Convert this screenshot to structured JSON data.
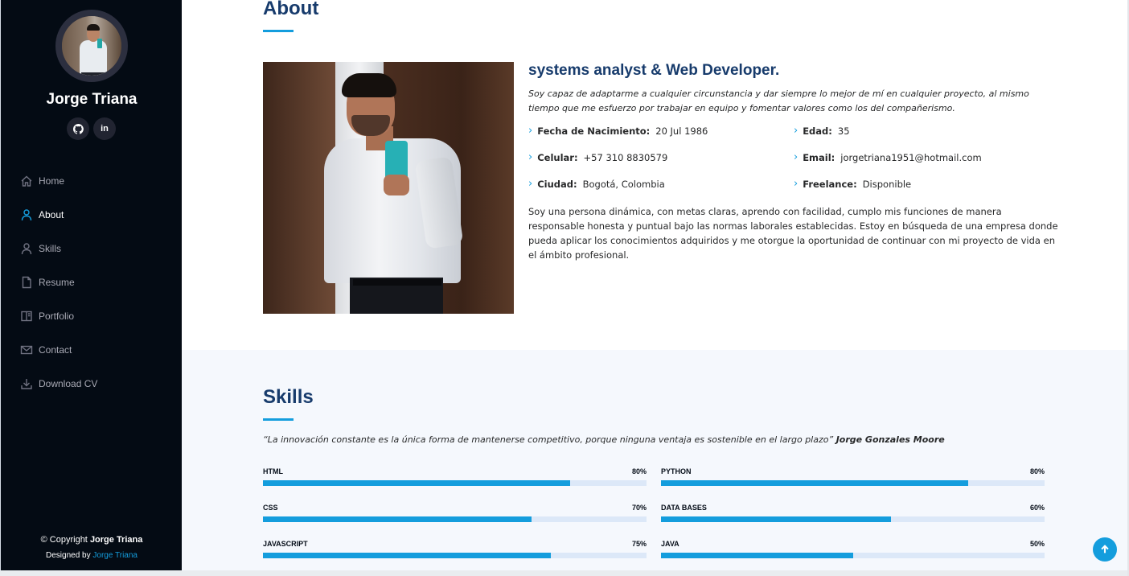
{
  "sidebar": {
    "name": "Jorge Triana",
    "social": [
      {
        "icon": "github-icon",
        "glyph": "●"
      },
      {
        "icon": "linkedin-icon",
        "glyph": "in"
      }
    ],
    "nav": [
      {
        "label": "Home",
        "icon": "home-icon"
      },
      {
        "label": "About",
        "icon": "person-icon",
        "active": true
      },
      {
        "label": "Skills",
        "icon": "person-icon"
      },
      {
        "label": "Resume",
        "icon": "file-icon"
      },
      {
        "label": "Portfolio",
        "icon": "book-icon"
      },
      {
        "label": "Contact",
        "icon": "envelope-icon"
      },
      {
        "label": "Download CV",
        "icon": "download-icon"
      }
    ],
    "copyright_prefix": "© Copyright",
    "copyright_name": "Jorge Triana",
    "credits_prefix": "Designed by",
    "credits_link": "Jorge Triana"
  },
  "about": {
    "title": "About",
    "role": "systems analyst & Web Developer.",
    "lead": "Soy capaz de adaptarme a cualquier circunstancia y dar siempre lo mejor de mí en cualquier proyecto, al mismo tiempo que me esfuerzo por trabajar en equipo y fomentar valores como los del compañerismo.",
    "info": [
      {
        "label": "Fecha de Nacimiento:",
        "value": "20 Jul 1986"
      },
      {
        "label": "Edad:",
        "value": "35"
      },
      {
        "label": "Celular:",
        "value": "+57 310 8830579"
      },
      {
        "label": "Email:",
        "value": "jorgetriana1951@hotmail.com"
      },
      {
        "label": "Ciudad:",
        "value": "Bogotá, Colombia"
      },
      {
        "label": "Freelance:",
        "value": "Disponible"
      }
    ],
    "bio": "Soy una persona dinámica, con metas claras, aprendo con facilidad, cumplo mis funciones de manera responsable honesta y puntual bajo las normas laborales establecidas. Estoy en búsqueda de una empresa donde pueda aplicar los conocimientos adquiridos y me otorgue la oportunidad de continuar con mi proyecto de vida en el ámbito profesional."
  },
  "skills": {
    "title": "Skills",
    "quote": "“La innovación constante es la única forma de mantenerse competitivo, porque ninguna ventaja es sostenible en el largo plazo”",
    "quote_author": "Jorge Gonzales Moore",
    "items": [
      {
        "name": "HTML",
        "percent_label": "80%",
        "percent": 80
      },
      {
        "name": "PYTHON",
        "percent_label": "80%",
        "percent": 80
      },
      {
        "name": "CSS",
        "percent_label": "70%",
        "percent": 70
      },
      {
        "name": "DATA BASES",
        "percent_label": "60%",
        "percent": 60
      },
      {
        "name": "JAVASCRIPT",
        "percent_label": "75%",
        "percent": 75
      },
      {
        "name": "JAVA",
        "percent_label": "50%",
        "percent": 50
      }
    ]
  },
  "colors": {
    "accent": "#149ddd",
    "sidebar_bg": "#040b14",
    "heading": "#173b6c",
    "skills_bg": "#f5f8fd"
  },
  "back_to_top": {
    "icon": "arrow-up-icon"
  }
}
